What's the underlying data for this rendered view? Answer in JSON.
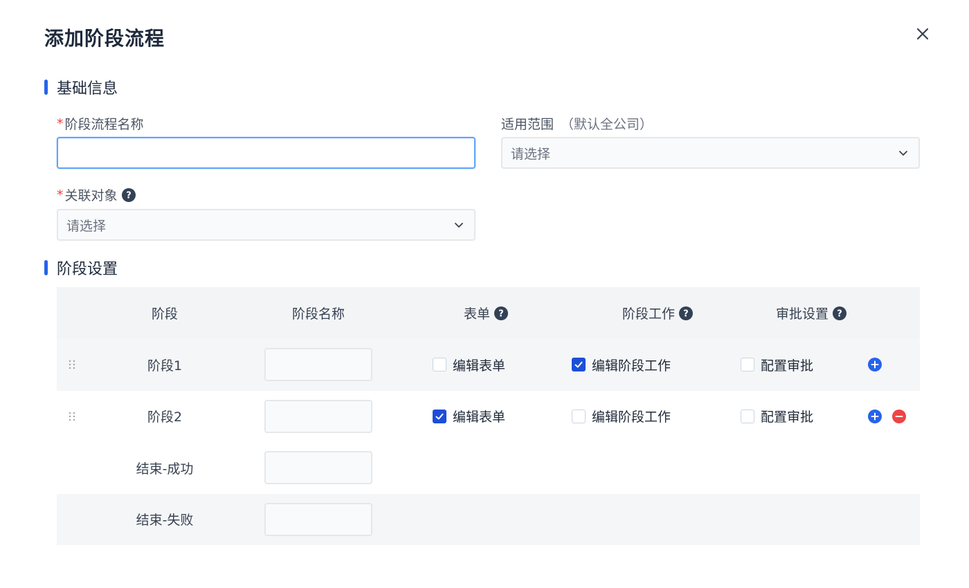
{
  "modal": {
    "title": "添加阶段流程"
  },
  "sections": {
    "basic": "基础信息",
    "stages": "阶段设置"
  },
  "form": {
    "name_label": "阶段流程名称",
    "name_value": "",
    "scope_label": "适用范围",
    "scope_hint": "（默认全公司）",
    "scope_placeholder": "请选择",
    "object_label": "关联对象",
    "object_placeholder": "请选择"
  },
  "table": {
    "headers": {
      "stage": "阶段",
      "name": "阶段名称",
      "form": "表单",
      "work": "阶段工作",
      "approval": "审批设置"
    },
    "rows": [
      {
        "stage": "阶段1",
        "form_label": "编辑表单",
        "form_checked": false,
        "work_label": "编辑阶段工作",
        "work_checked": true,
        "approval_label": "配置审批",
        "approval_checked": false
      },
      {
        "stage": "阶段2",
        "form_label": "编辑表单",
        "form_checked": true,
        "work_label": "编辑阶段工作",
        "work_checked": false,
        "approval_label": "配置审批",
        "approval_checked": false
      },
      {
        "stage": "结束-成功"
      },
      {
        "stage": "结束-失败"
      }
    ]
  },
  "colors": {
    "accent": "#2563eb",
    "danger": "#ef4444"
  }
}
